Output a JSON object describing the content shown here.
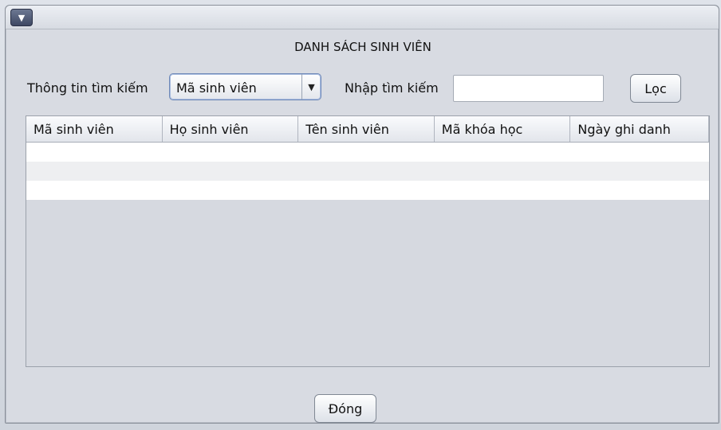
{
  "window": {
    "menu_icon": "chevron-down-icon",
    "menu_glyph": "▼"
  },
  "page": {
    "title": "DANH SÁCH SINH VIÊN"
  },
  "search": {
    "criteria_label": "Thông tin tìm kiếm",
    "criteria_selected": "Mã sinh viên",
    "input_label": "Nhập tìm kiếm",
    "input_value": "",
    "filter_button": "Lọc"
  },
  "table": {
    "columns": [
      "Mã sinh viên",
      "Họ sinh viên",
      "Tên sinh viên",
      "Mã khóa học",
      "Ngày ghi danh"
    ],
    "rows": []
  },
  "footer": {
    "close_button": "Đóng"
  }
}
